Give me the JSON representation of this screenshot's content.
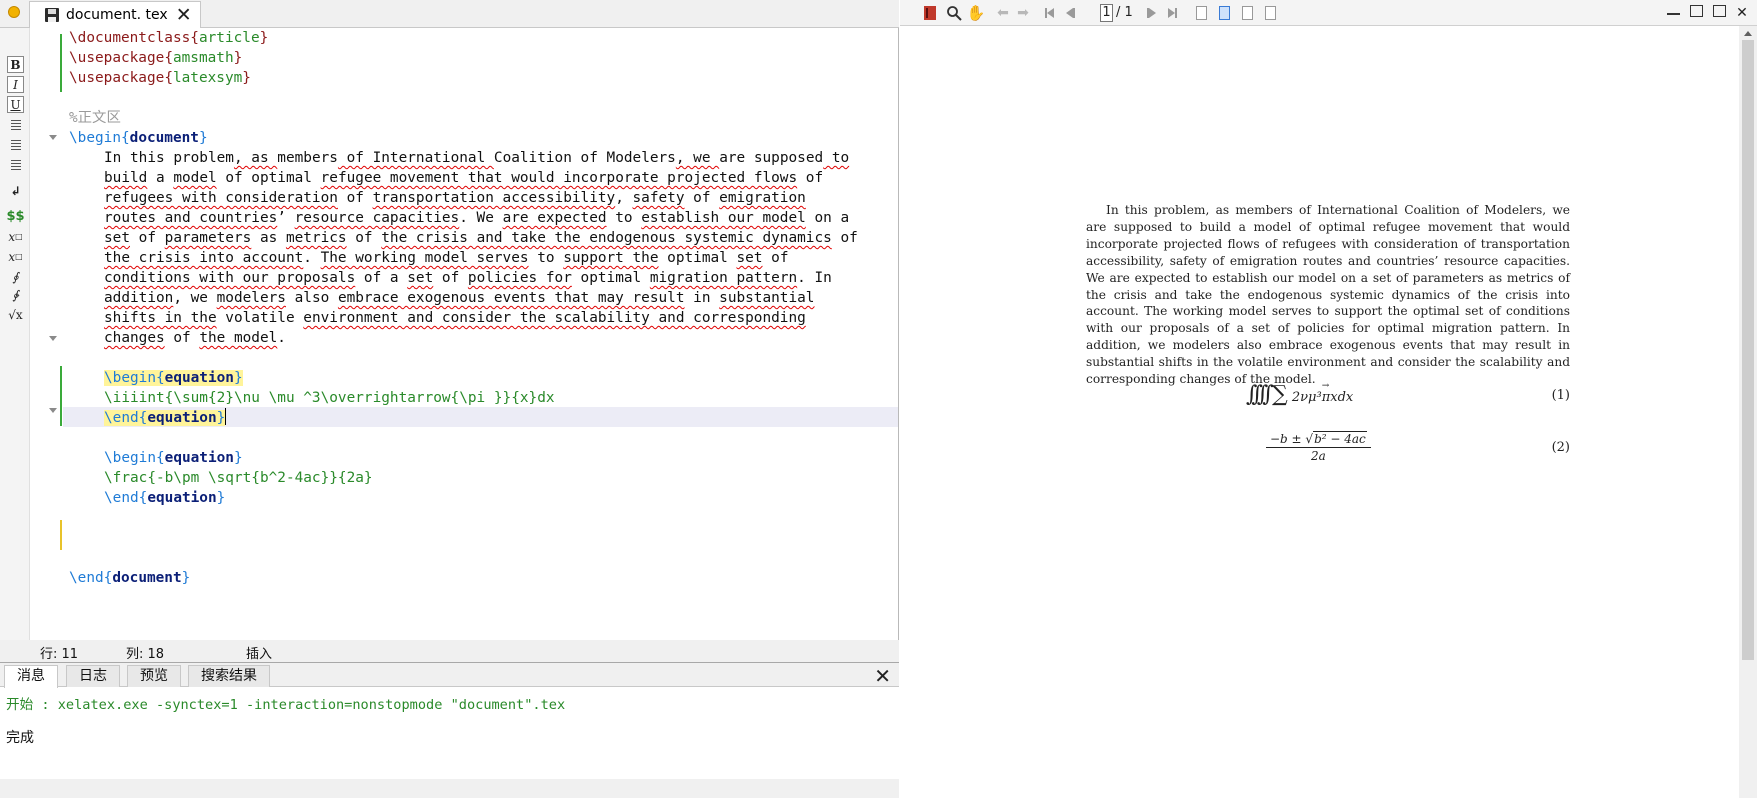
{
  "editor": {
    "tab_title": "document. tex",
    "status": {
      "row_label": "行: 11",
      "col_label": "列: 18",
      "mode": "插入"
    }
  },
  "code_lines": {
    "l1": {
      "cmd": "\\documentclass",
      "ob": "{",
      "arg": "article",
      "cb": "}"
    },
    "l2": {
      "cmd": "\\usepackage",
      "ob": "{",
      "arg": "amsmath",
      "cb": "}"
    },
    "l3": {
      "cmd": "\\usepackage",
      "ob": "{",
      "arg": "latexsym",
      "cb": "}"
    },
    "l5": "%正文区",
    "l6": {
      "kw": "\\begin",
      "ob": "{",
      "env": "document",
      "cb": "}"
    },
    "l7": [
      "In ",
      "this problem",
      ", as ",
      "members",
      " of International ",
      "Coalition of Modelers",
      ", we ",
      "are supposed",
      " to"
    ],
    "l8": [
      "build",
      " a ",
      "model",
      " of optimal ",
      "refugee movement that would incorporate projected flows",
      " of"
    ],
    "l9": [
      "refugees with consideration",
      " of ",
      "transportation accessibility",
      ", ",
      "safety",
      " of ",
      "emigration"
    ],
    "l10": [
      "routes and countries",
      "’ ",
      "resource capacities",
      ". We ",
      "are expected",
      " to ",
      "establish our model",
      " on a"
    ],
    "l11": [
      "set",
      " of ",
      "parameters",
      " as ",
      "metrics",
      " of ",
      "the crisis and take the endogenous systemic dynamics",
      " of"
    ],
    "l12": [
      "the crisis into account",
      ". ",
      "The working model serves",
      " to ",
      "support the",
      " optimal ",
      "set",
      " of"
    ],
    "l13": [
      "conditions with our proposals",
      " of a ",
      "set",
      " of ",
      "policies for",
      " optimal ",
      "migration pattern",
      ". In"
    ],
    "l14": [
      "addition",
      ", we ",
      "modelers",
      " also ",
      "embrace exogenous events that may result",
      " in ",
      "substantial"
    ],
    "l15": [
      "shifts in the",
      " volatile ",
      "environment and consider the scalability and corresponding"
    ],
    "l16": [
      "changes",
      " of ",
      "the model",
      "."
    ],
    "l18": {
      "kw": "\\begin",
      "ob": "{",
      "env": "equation",
      "cb": "}"
    },
    "l19": "\\iiiint{\\sum{2}\\nu \\mu ^3\\overrightarrow{\\pi }}{x}dx",
    "l20": {
      "kw": "\\end",
      "ob": "{",
      "env": "equation",
      "cb": "}"
    },
    "l22": {
      "kw": "\\begin",
      "ob": "{",
      "env": "equation",
      "cb": "}"
    },
    "l23": "\\frac{-b\\pm \\sqrt{b^2-4ac}}{2a}",
    "l24": {
      "kw": "\\end",
      "ob": "{",
      "env": "equation",
      "cb": "}"
    },
    "l27": {
      "kw": "\\end",
      "ob": "{",
      "env": "document",
      "cb": "}"
    }
  },
  "messages": {
    "tabs": [
      "消息",
      "日志",
      "预览",
      "搜索结果"
    ],
    "line1": "开始 : xelatex.exe -synctex=1 -interaction=nonstopmode \"document\".tex",
    "line2": "完成"
  },
  "pdf": {
    "page_current": "1",
    "page_total": "/ 1",
    "paragraph": "In this problem, as members of International Coalition of Modelers, we are supposed to build a model of optimal refugee movement that would incorporate projected flows of refugees with consideration of transportation accessibility, safety of emigration routes and countries’ resource capacities. We are expected to establish our model on a set of parameters as metrics of the crisis and take the endogenous systemic dynamics of the crisis into account. The working model serves to support the optimal set of conditions with our proposals of a set of policies for optimal migration pattern. In addition, we modelers also embrace exogenous events that may result in substantial shifts in the volatile environment and consider the scalability and corresponding changes of the model.",
    "eq1": {
      "integrals": "∫∫∫∫",
      "sum": "∑",
      "body": "2νμ³",
      "pi": "π",
      "tail": "xdx",
      "number": "(1)"
    },
    "eq2": {
      "numerator_pre": "−b ± √",
      "radicand": "b² − 4ac",
      "denominator": "2a",
      "number": "(2)"
    }
  },
  "icons": {
    "tab_save": "floppy-disk-icon",
    "pdf_toolbar": [
      "pdf-book-icon",
      "zoom-icon",
      "hand-icon",
      "back-icon",
      "forward-icon",
      "first-page-icon",
      "prev-page-icon",
      "next-page-icon",
      "last-page-icon",
      "single-page-icon",
      "continuous-page-icon",
      "double-page-icon",
      "fit-page-icon"
    ]
  },
  "colors": {
    "command": "#8b1a1a",
    "argument": "#2a8a2a",
    "begin_end": "#1f7bd6",
    "environment": "#0b1f77",
    "highlight": "#fff49a"
  }
}
